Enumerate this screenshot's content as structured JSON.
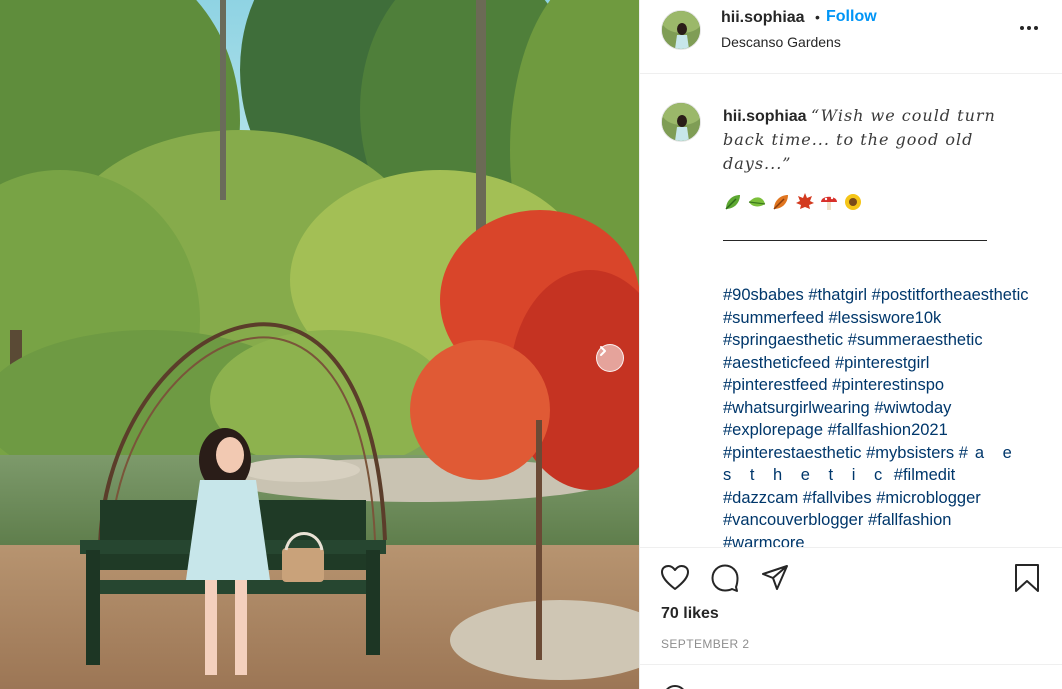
{
  "post": {
    "username": "hii.sophiaa",
    "follow_label": "Follow",
    "separator": "•",
    "location": "Descanso Gardens"
  },
  "caption": {
    "username": "hii.sophiaa",
    "quote": "“Wish we could turn back time... to the good old days...”",
    "emojis": [
      "leaf-emoji",
      "herb-emoji",
      "fallen-leaf-emoji",
      "maple-leaf-emoji",
      "mushroom-emoji",
      "sunflower-emoji"
    ],
    "divider": "________________________________",
    "hashtags": [
      "#90sbabes",
      "#thatgirl",
      "#postitfortheaesthetic",
      "#summerfeed",
      "#lessiswore10k",
      "#springaesthetic",
      "#summeraesthetic",
      "#aestheticfeed",
      "#pinterestgirl",
      "#pinterestfeed",
      "#pinterestinspo",
      "#whatsurgirlwearing",
      "#wiwtoday",
      "#explorepage",
      "#fallfashion2021",
      "#pinterestaesthetic",
      "#mybsisters",
      "#aesthetic",
      "#filmedit",
      "#dazzcam",
      "#fallvibes",
      "#microblogger",
      "#vancouverblogger",
      "#fallfashion",
      "#warmcore"
    ],
    "hashtag_wide_display": "#a e s t h e t i c"
  },
  "engagement": {
    "likes": "70 likes",
    "date": "SEPTEMBER 2"
  },
  "icons": {
    "more": "more-options-icon",
    "like": "heart-icon",
    "comment": "comment-bubble-icon",
    "share": "paper-plane-icon",
    "save": "bookmark-icon",
    "carousel_next": "chevron-right-icon"
  },
  "colors": {
    "follow": "#0095f6",
    "hashtag": "#00376b",
    "text": "#262626",
    "muted": "#8e8e8e"
  }
}
